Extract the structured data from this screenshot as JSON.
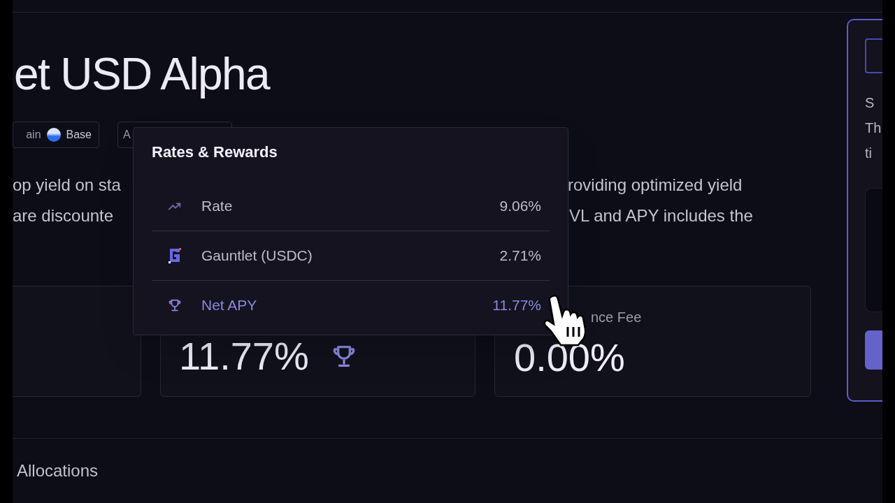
{
  "title": "et USD Alpha",
  "chips": [
    {
      "label": "ain",
      "value": "Base"
    },
    {
      "label": "A"
    }
  ],
  "description": [
    {
      "left": "op yield on sta",
      "right": "roviding optimized yield"
    },
    {
      "left": "are discounte",
      "right": "VL and APY includes the"
    }
  ],
  "stats": [
    {
      "kind": "empty"
    },
    {
      "kind": "apy",
      "value": "11.77%"
    },
    {
      "kind": "fee",
      "label": "nce Fee",
      "value": "0.00%"
    }
  ],
  "section": "Allocations",
  "side_panel": {
    "lines": [
      "S",
      "Th",
      "ti"
    ]
  },
  "popover": {
    "title": "Rates & Rewards",
    "rows": [
      {
        "kind": "rate",
        "label": "Rate",
        "value": "9.06%",
        "highlighted": false
      },
      {
        "kind": "gauntlet",
        "label": "Gauntlet (USDC)",
        "value": "2.71%",
        "highlighted": false
      },
      {
        "kind": "trophy",
        "label": "Net APY",
        "value": "11.77%",
        "highlighted": true
      }
    ]
  }
}
